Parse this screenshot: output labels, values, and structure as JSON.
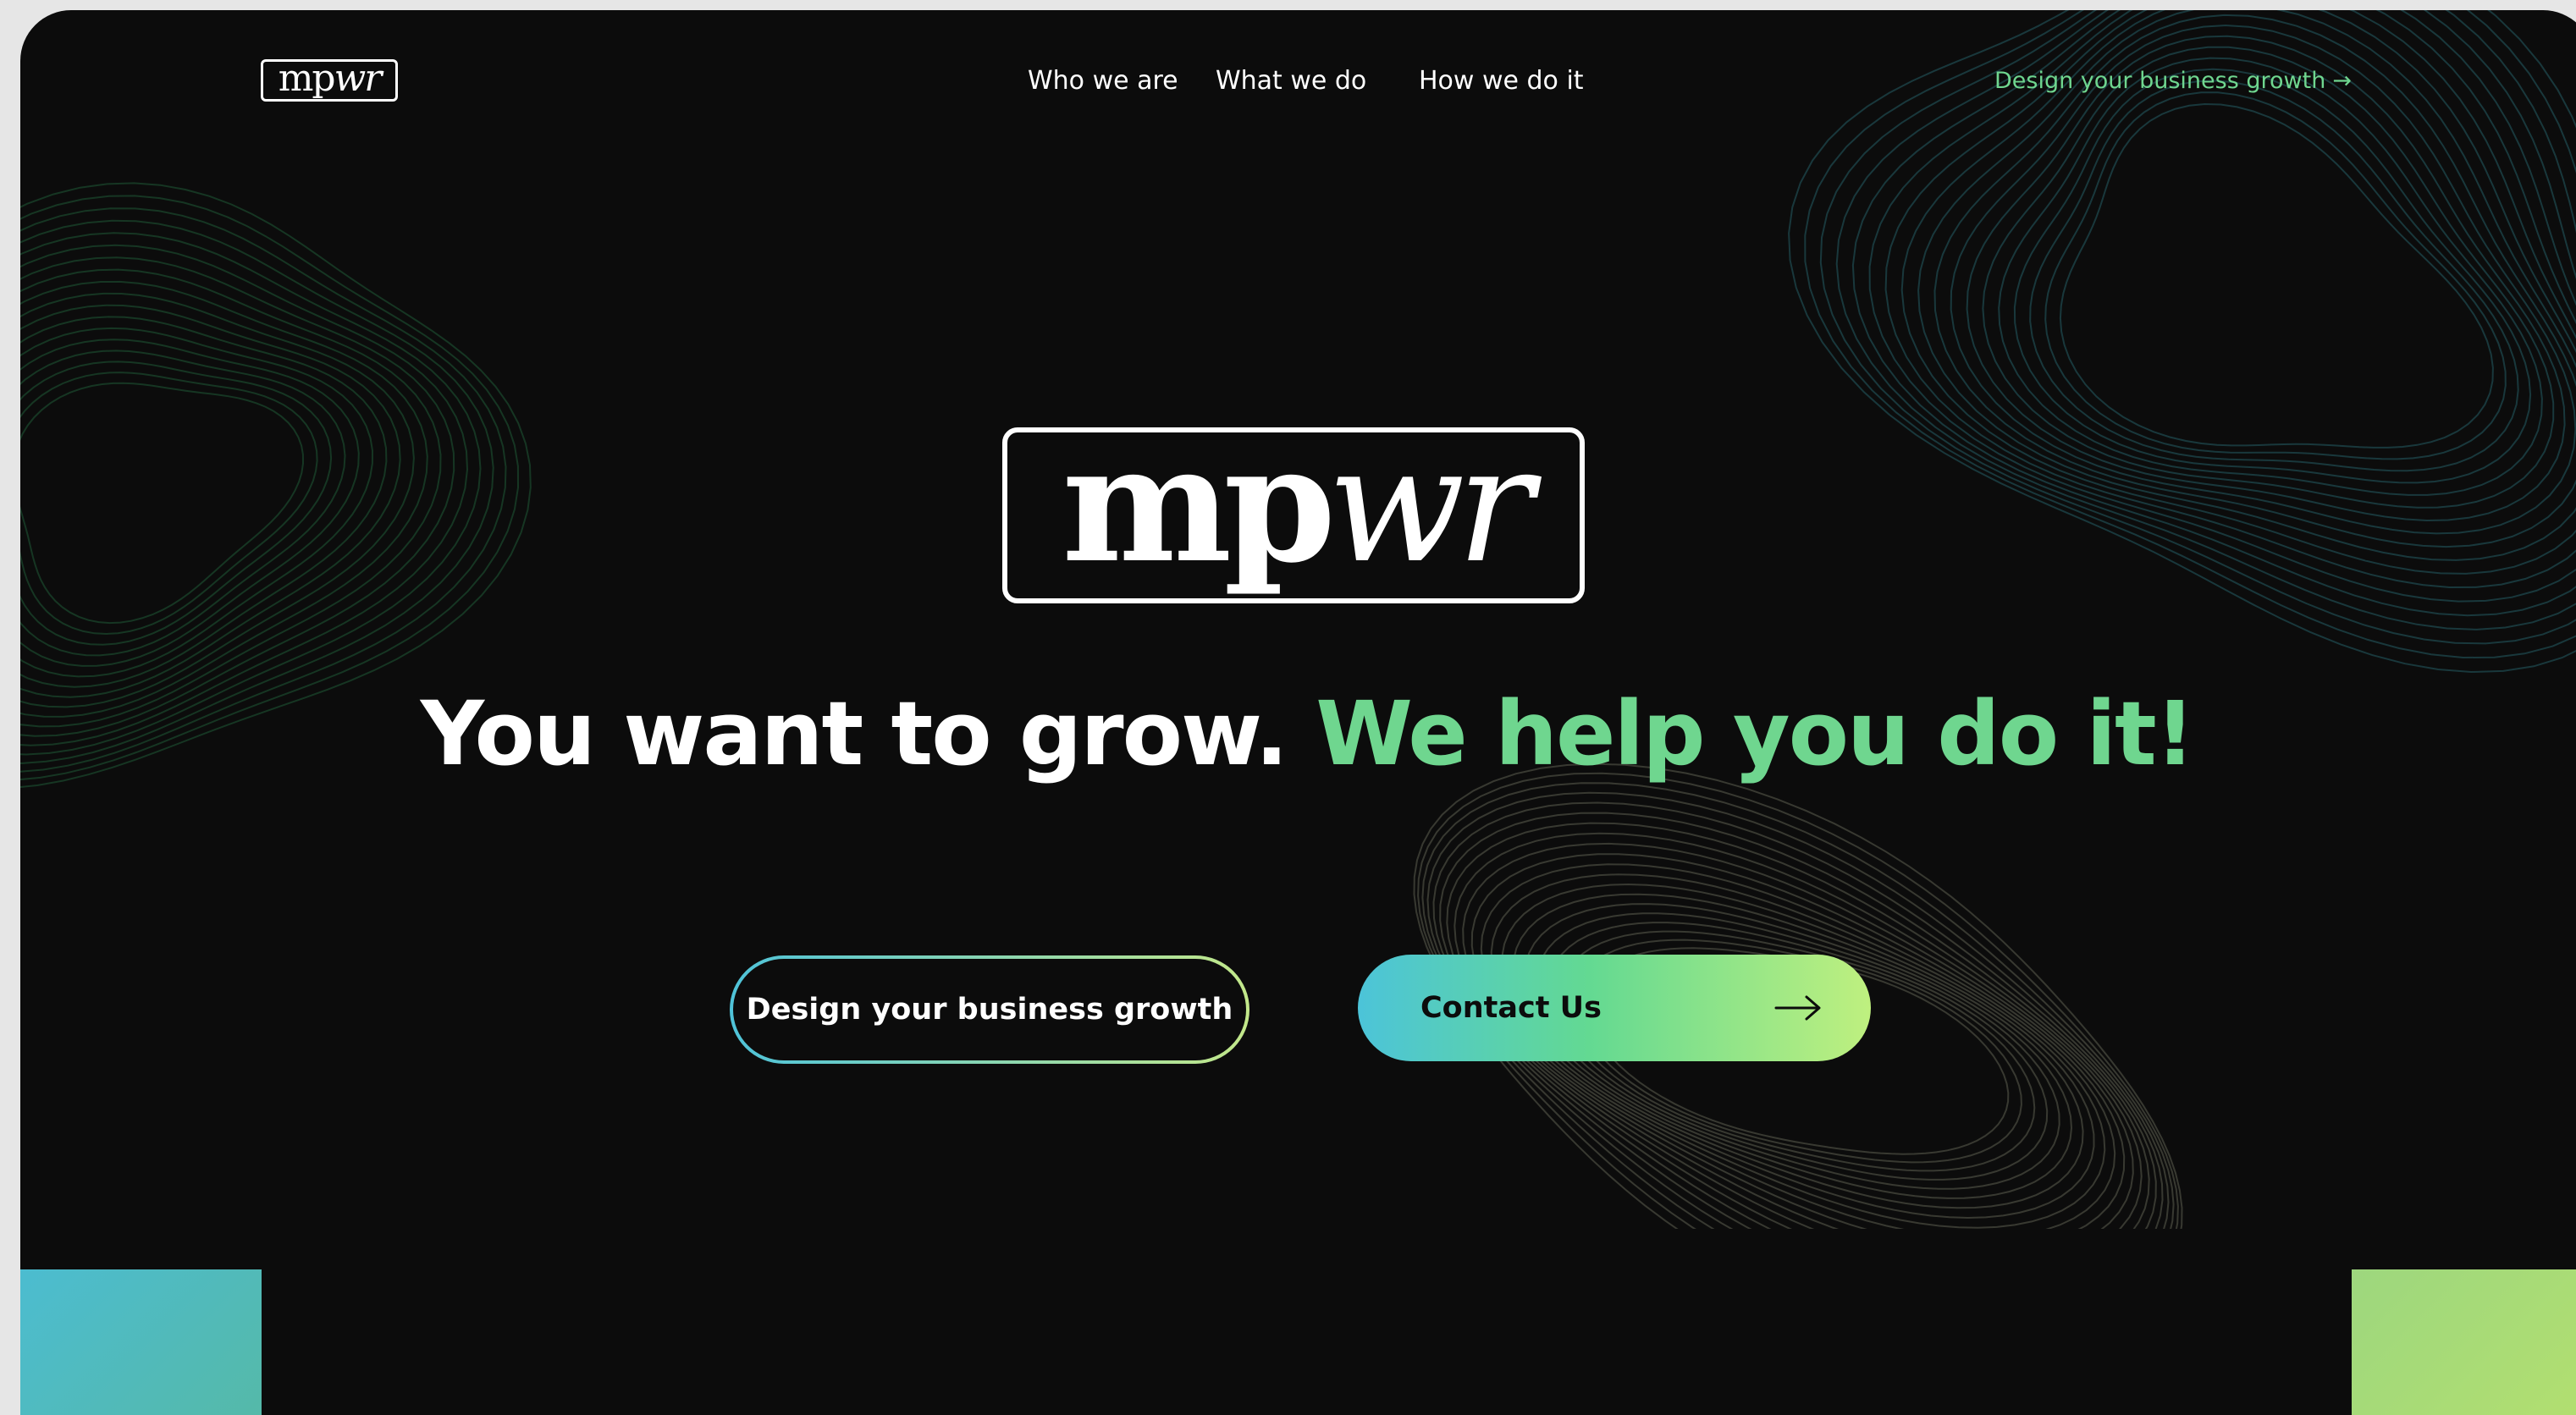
{
  "header": {
    "logo_text": "mpwr",
    "logo_plain": "mp",
    "logo_italic": "wr",
    "nav": [
      {
        "label": "Who we are"
      },
      {
        "label": "What we do"
      },
      {
        "label": "How we do it"
      }
    ],
    "cta_label": "Design your business growth",
    "cta_arrow": "→"
  },
  "hero": {
    "logo_plain": "mp",
    "logo_italic": "wr",
    "headline_white": "You want to grow.",
    "headline_green": "We help you do it!",
    "primary_button": "Design your business growth",
    "secondary_button": "Contact Us"
  },
  "icons": {
    "header_cta_icon": "arrow-right-icon",
    "contact_icon": "arrow-right-icon"
  },
  "colors": {
    "background": "#0c0c0c",
    "accent_green": "#6fd68f",
    "gradient_start": "#4cc4d9",
    "gradient_end": "#bff07f",
    "text": "#ffffff"
  }
}
